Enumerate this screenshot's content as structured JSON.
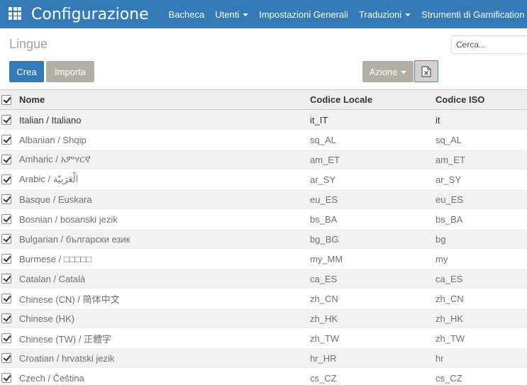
{
  "navbar": {
    "app_icon": "apps-grid-icon",
    "title": "Configurazione",
    "menu": [
      {
        "label": "Bacheca",
        "dropdown": false
      },
      {
        "label": "Utenti",
        "dropdown": true
      },
      {
        "label": "Impostazioni Generali",
        "dropdown": false
      },
      {
        "label": "Traduzioni",
        "dropdown": true
      },
      {
        "label": "Strumenti di Gamification",
        "dropdown": true
      }
    ]
  },
  "control_panel": {
    "breadcrumb": "Lingue",
    "search_placeholder": "Cerca...",
    "create_label": "Crea",
    "import_label": "Importa",
    "action_label": "Azione",
    "export_icon": "excel-export-icon"
  },
  "table": {
    "columns": [
      "Nome",
      "Codice Locale",
      "Codice ISO"
    ],
    "rows": [
      {
        "name": "Italian / Italiano",
        "locale": "it_IT",
        "iso": "it"
      },
      {
        "name": "Albanian / Shqip",
        "locale": "sq_AL",
        "iso": "sq_AL"
      },
      {
        "name": "Amharic / አምሃርኛ",
        "locale": "am_ET",
        "iso": "am_ET"
      },
      {
        "name": "Arabic / الْعَرَبيّة",
        "locale": "ar_SY",
        "iso": "ar_SY"
      },
      {
        "name": "Basque / Euskara",
        "locale": "eu_ES",
        "iso": "eu_ES"
      },
      {
        "name": "Bosnian / bosanski jezik",
        "locale": "bs_BA",
        "iso": "bs_BA"
      },
      {
        "name": "Bulgarian / български език",
        "locale": "bg_BG",
        "iso": "bg"
      },
      {
        "name": "Burmese / □□□□□",
        "locale": "my_MM",
        "iso": "my"
      },
      {
        "name": "Catalan / Català",
        "locale": "ca_ES",
        "iso": "ca_ES"
      },
      {
        "name": "Chinese (CN) / 简体中文",
        "locale": "zh_CN",
        "iso": "zh_CN"
      },
      {
        "name": "Chinese (HK)",
        "locale": "zh_HK",
        "iso": "zh_HK"
      },
      {
        "name": "Chinese (TW) / 正體字",
        "locale": "zh_TW",
        "iso": "zh_TW"
      },
      {
        "name": "Croatian / hrvatski jezik",
        "locale": "hr_HR",
        "iso": "hr"
      },
      {
        "name": "Czech / Čeština",
        "locale": "cs_CZ",
        "iso": "cs_CZ"
      }
    ]
  },
  "colors": {
    "navbar": "#337ab7",
    "primary_button": "#337ab7",
    "secondary_button": "#b5aea7"
  }
}
